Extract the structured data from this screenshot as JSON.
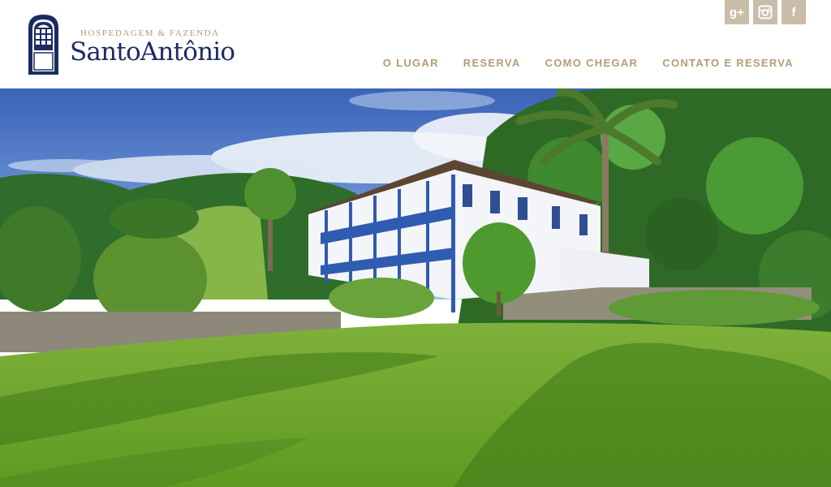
{
  "brand": {
    "subtitle": "HOSPEDAGEM & FAZENDA",
    "name": "SantoAntônio"
  },
  "social": [
    {
      "icon": "google-plus-icon",
      "glyph": "g+"
    },
    {
      "icon": "instagram-icon",
      "glyph": ""
    },
    {
      "icon": "facebook-icon",
      "glyph": "f"
    }
  ],
  "nav": {
    "items": [
      {
        "label": "O LUGAR"
      },
      {
        "label": "RESERVA"
      },
      {
        "label": "COMO CHEGAR"
      },
      {
        "label": "CONTATO E RESERVA"
      }
    ]
  },
  "colors": {
    "brand_navy": "#1b2c63",
    "accent_gold": "#b59b76",
    "social_bg": "#c9bdaa"
  }
}
